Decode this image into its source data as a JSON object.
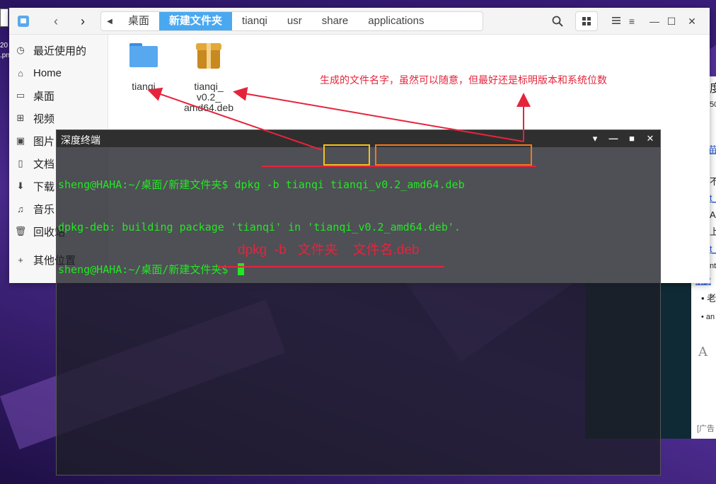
{
  "desktop": {
    "file_label_1": "20",
    "file_label_2": ".png"
  },
  "browser": {
    "lines": [
      "度",
      "50",
      "苗",
      "不",
      "t_",
      "AM",
      "上",
      "t_",
      "nt",
      "航武",
      "• 老",
      "• an",
      "A",
      "[广告"
    ]
  },
  "file_manager": {
    "nav_back_icon": "chevron-left-icon",
    "nav_forward_icon": "chevron-right-icon",
    "breadcrumbs": [
      "桌面",
      "新建文件夹",
      "tianqi",
      "usr",
      "share",
      "applications"
    ],
    "active_crumb": "新建文件夹",
    "sidebar": [
      {
        "label": "最近使用的",
        "icon": "clock-icon"
      },
      {
        "label": "Home",
        "icon": "home-icon"
      },
      {
        "label": "桌面",
        "icon": "desktop-icon"
      },
      {
        "label": "视频",
        "icon": "video-icon"
      },
      {
        "label": "图片",
        "icon": "image-icon"
      },
      {
        "label": "文档",
        "icon": "document-icon"
      },
      {
        "label": "下载",
        "icon": "download-icon"
      },
      {
        "label": "音乐",
        "icon": "music-icon"
      },
      {
        "label": "回收站",
        "icon": "trash-icon"
      },
      {
        "label": "其他位置",
        "icon": "plus-icon"
      }
    ],
    "files": [
      {
        "name": "tianqi",
        "type": "folder"
      },
      {
        "name_lines": [
          "tianqi_",
          "v0.2_",
          "amd64.deb"
        ],
        "type": "deb"
      }
    ],
    "annotation": "生成的文件名字，虽然可以随意，但最好还是标明版本和系统位数"
  },
  "terminal": {
    "title": "深度终端",
    "lines": [
      {
        "prompt": "sheng@HAHA:~/桌面/新建文件夹$ ",
        "command": "dpkg -b tianqi tianqi_v0.2_amd64.deb"
      },
      {
        "output": "dpkg-deb: building package 'tianqi' in 'tianqi_v0.2_amd64.deb'."
      },
      {
        "prompt": "sheng@HAHA:~/桌面/新建文件夹$ ",
        "command": ""
      }
    ],
    "annotation": "dpkg  -b   文件夹    文件名.deb",
    "text_color": "#22e822",
    "annotation_color": "#e5243b"
  }
}
